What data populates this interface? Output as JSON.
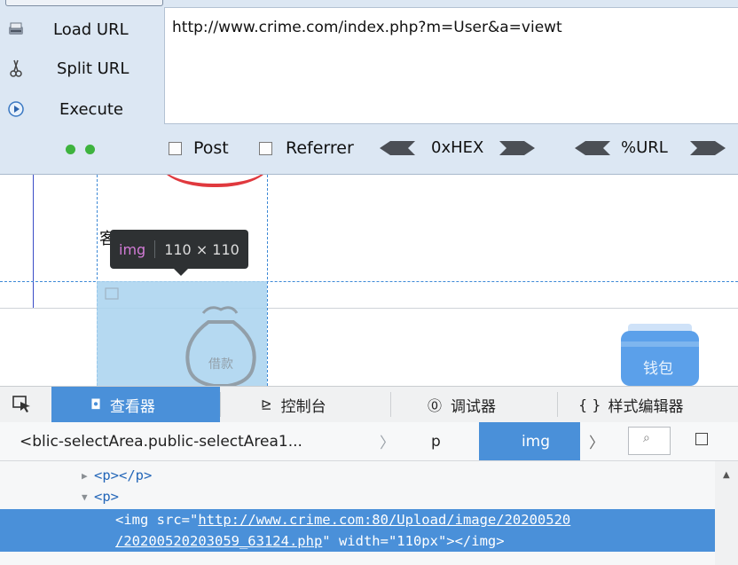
{
  "hackbar": {
    "menu": [
      {
        "label": "Load URL",
        "icon": "load-url-icon"
      },
      {
        "label": "Split URL",
        "icon": "scissors-icon"
      },
      {
        "label": "Execute",
        "icon": "play-icon"
      }
    ],
    "url_value": "http://www.crime.com/index.php?m=User&a=viewt",
    "post_label": "Post",
    "referrer_label": "Referrer",
    "hex_label": "0xHEX",
    "url_enc_label": "%URL"
  },
  "page": {
    "partial_text": "客",
    "tooltip_tag": "img",
    "tooltip_dims": "110 × 110",
    "wallet_label": "钱包",
    "moneybag_text": "借款"
  },
  "devtools": {
    "tabs": [
      "查看器",
      "控制台",
      "调试器",
      "样式编辑器"
    ],
    "breadcrumb": {
      "first": "<blic-selectArea.public-selectArea1...",
      "p": "p",
      "img": "img"
    },
    "tree": [
      {
        "indent": 1,
        "twisty": "▶",
        "text": "<p></p>"
      },
      {
        "indent": 1,
        "twisty": "▼",
        "text": "<p>"
      },
      {
        "indent": 2,
        "twisty": "",
        "text_pre": "<img src=\"",
        "link": "http://www.crime.com:80/Upload/image/20200520",
        "text_post": ""
      },
      {
        "indent": 2,
        "twisty": "",
        "text_pre": "",
        "link": "/20200520203059_63124.php",
        "text_post": "\" width=\"110px\"></img>"
      }
    ]
  },
  "colors": {
    "hackbar_bg": "#dce7f3",
    "devtools_accent": "#4a90d9",
    "tooltip_bg": "#2e3133",
    "tag_purple": "#d27bd6"
  }
}
